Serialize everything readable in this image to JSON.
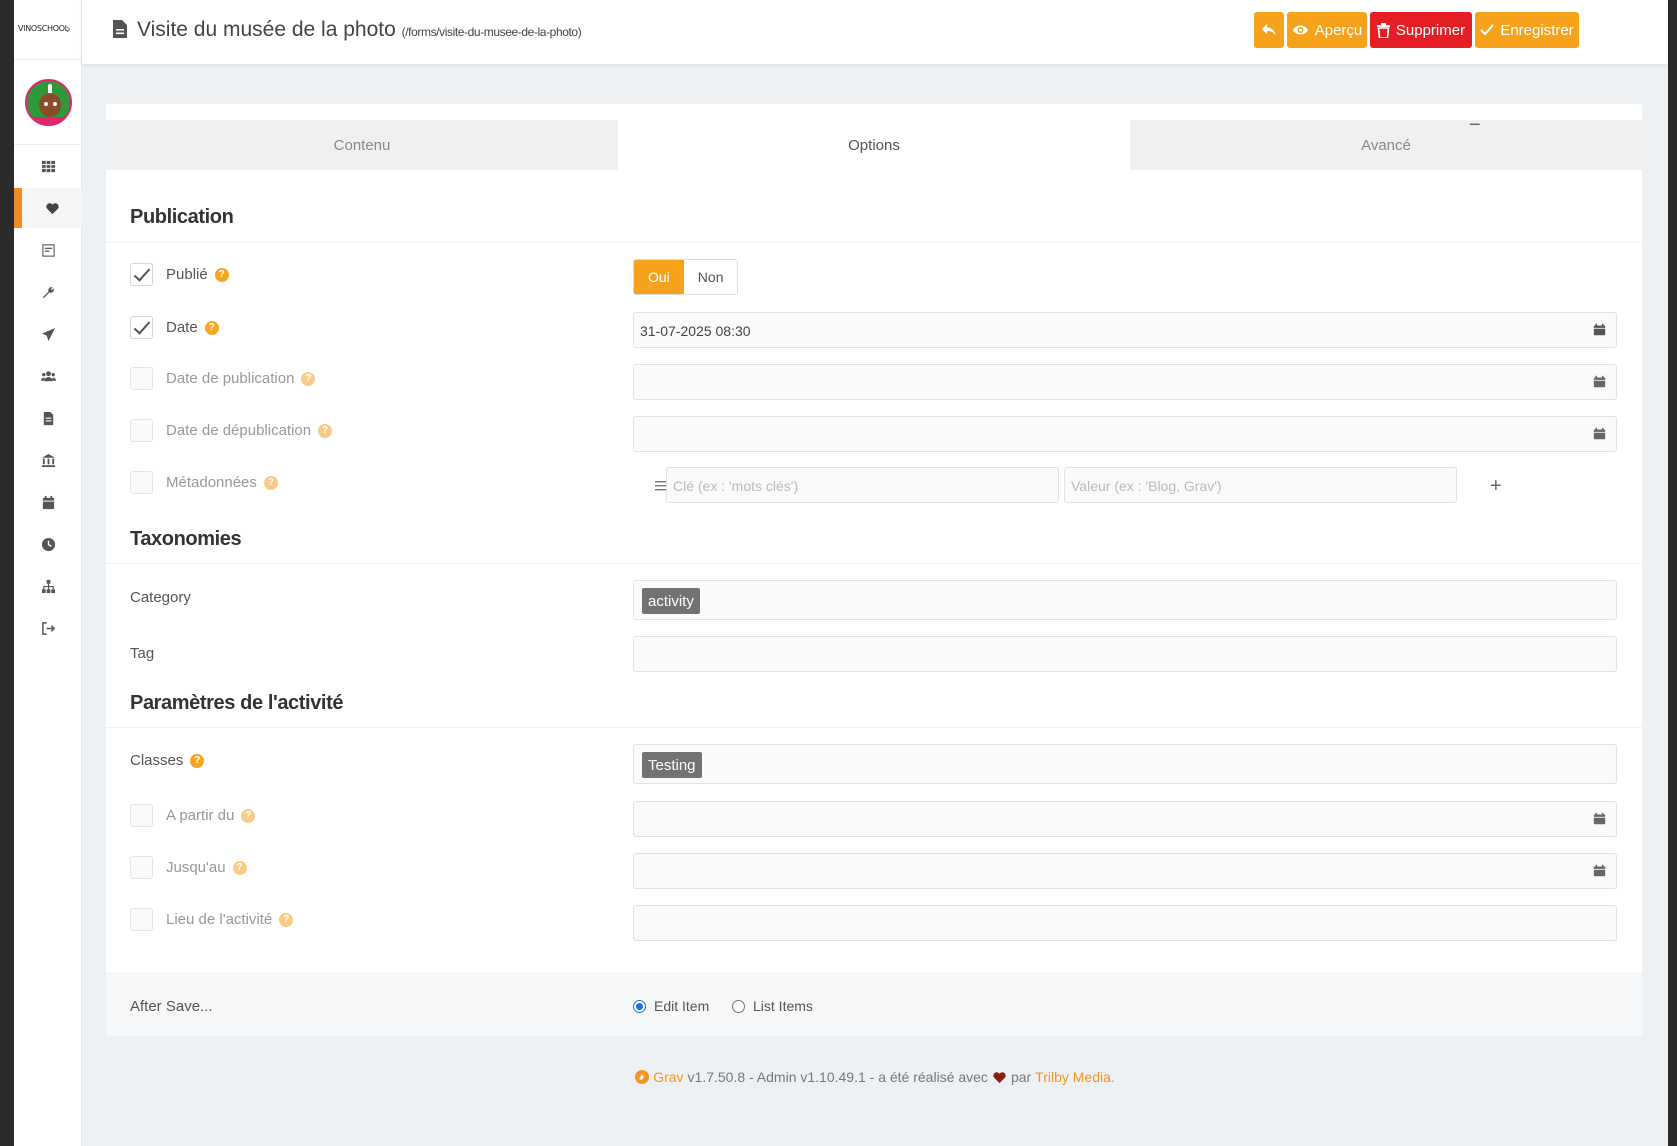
{
  "app": {
    "logo_text": "VINOSCHOOL"
  },
  "header": {
    "title": "Visite du musée de la photo",
    "route": "(/forms/visite-du-musee-de-la-photo)",
    "buttons": {
      "back": "",
      "preview": "Aperçu",
      "delete": "Supprimer",
      "save": "Enregistrer"
    }
  },
  "tabs": [
    "Contenu",
    "Options",
    "Avancé"
  ],
  "sections": {
    "publication": "Publication",
    "taxonomies": "Taxonomies",
    "activity": "Paramètres de l'activité"
  },
  "fields": {
    "published": {
      "label": "Publié",
      "checked": true,
      "options": [
        "Oui",
        "Non"
      ],
      "selected": "Oui"
    },
    "date": {
      "label": "Date",
      "checked": true,
      "value": "31-07-2025 08:30"
    },
    "publish_date": {
      "label": "Date de publication",
      "checked": false,
      "value": ""
    },
    "unpublish_date": {
      "label": "Date de dépublication",
      "checked": false,
      "value": ""
    },
    "metadata": {
      "label": "Métadonnées",
      "checked": false,
      "key_placeholder": "Clé (ex : 'mots clés')",
      "value_placeholder": "Valeur (ex : 'Blog, Grav')",
      "remove": "−",
      "add": "+"
    },
    "category": {
      "label": "Category",
      "tags": [
        "activity"
      ]
    },
    "tag": {
      "label": "Tag",
      "tags": []
    },
    "classes": {
      "label": "Classes",
      "tags": [
        "Testing"
      ]
    },
    "from": {
      "label": "A partir du",
      "checked": false,
      "value": ""
    },
    "until": {
      "label": "Jusqu'au",
      "checked": false,
      "value": ""
    },
    "location": {
      "label": "Lieu de l'activité",
      "checked": false,
      "value": ""
    }
  },
  "after_save": {
    "label": "After Save...",
    "options": [
      "Edit Item",
      "List Items"
    ],
    "selected": "Edit Item"
  },
  "footer": {
    "grav": "Grav",
    "text1": "v1.7.50.8 - Admin v1.10.49.1 - a été réalisé avec",
    "text2": "par",
    "trilby": "Trilby Media",
    "dot": "."
  },
  "colors": {
    "accent": "#f7a21b",
    "danger": "#e41e24",
    "chip": "#727272"
  }
}
